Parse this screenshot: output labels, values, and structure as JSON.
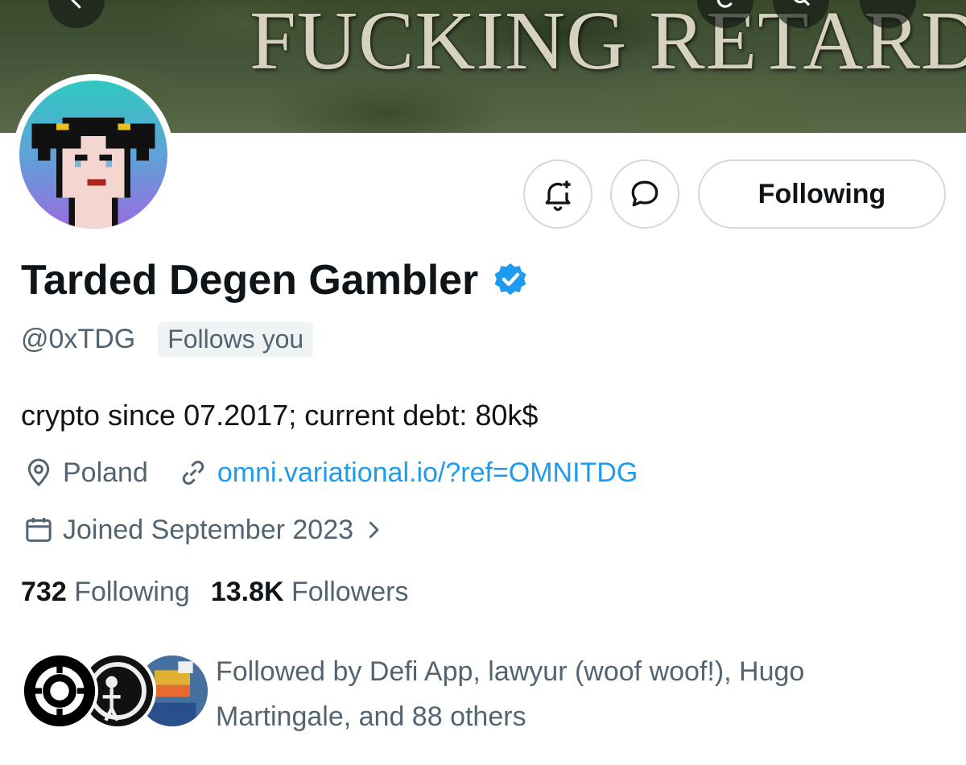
{
  "banner": {
    "text": "FUCKING RETARD"
  },
  "profile": {
    "display_name": "Tarded Degen Gambler",
    "verified": true,
    "handle": "@0xTDG",
    "follows_you": "Follows you",
    "bio": "crypto since 07.2017; current debt: 80k$",
    "location": "Poland",
    "website": "omni.variational.io/?ref=OMNITDG",
    "joined": "Joined September 2023",
    "following_count": "732",
    "following_label": "Following",
    "followers_count": "13.8K",
    "followers_label": "Followers",
    "followed_by": "Followed by Defi App, lawyur (woof woof!), Hugo Martingale, and 88 others"
  },
  "actions": {
    "following_button": "Following"
  },
  "icons": {
    "back": "back-arrow-icon",
    "search": "search-icon",
    "notify": "bell-plus-icon",
    "message": "chat-bubble-icon",
    "verified": "verified-badge-icon",
    "location": "location-pin-icon",
    "link": "link-icon",
    "calendar": "calendar-icon",
    "chevron": "chevron-right-icon"
  },
  "colors": {
    "accent": "#1d9bf0",
    "secondary_text": "#536471",
    "primary_text": "#0f1419"
  }
}
